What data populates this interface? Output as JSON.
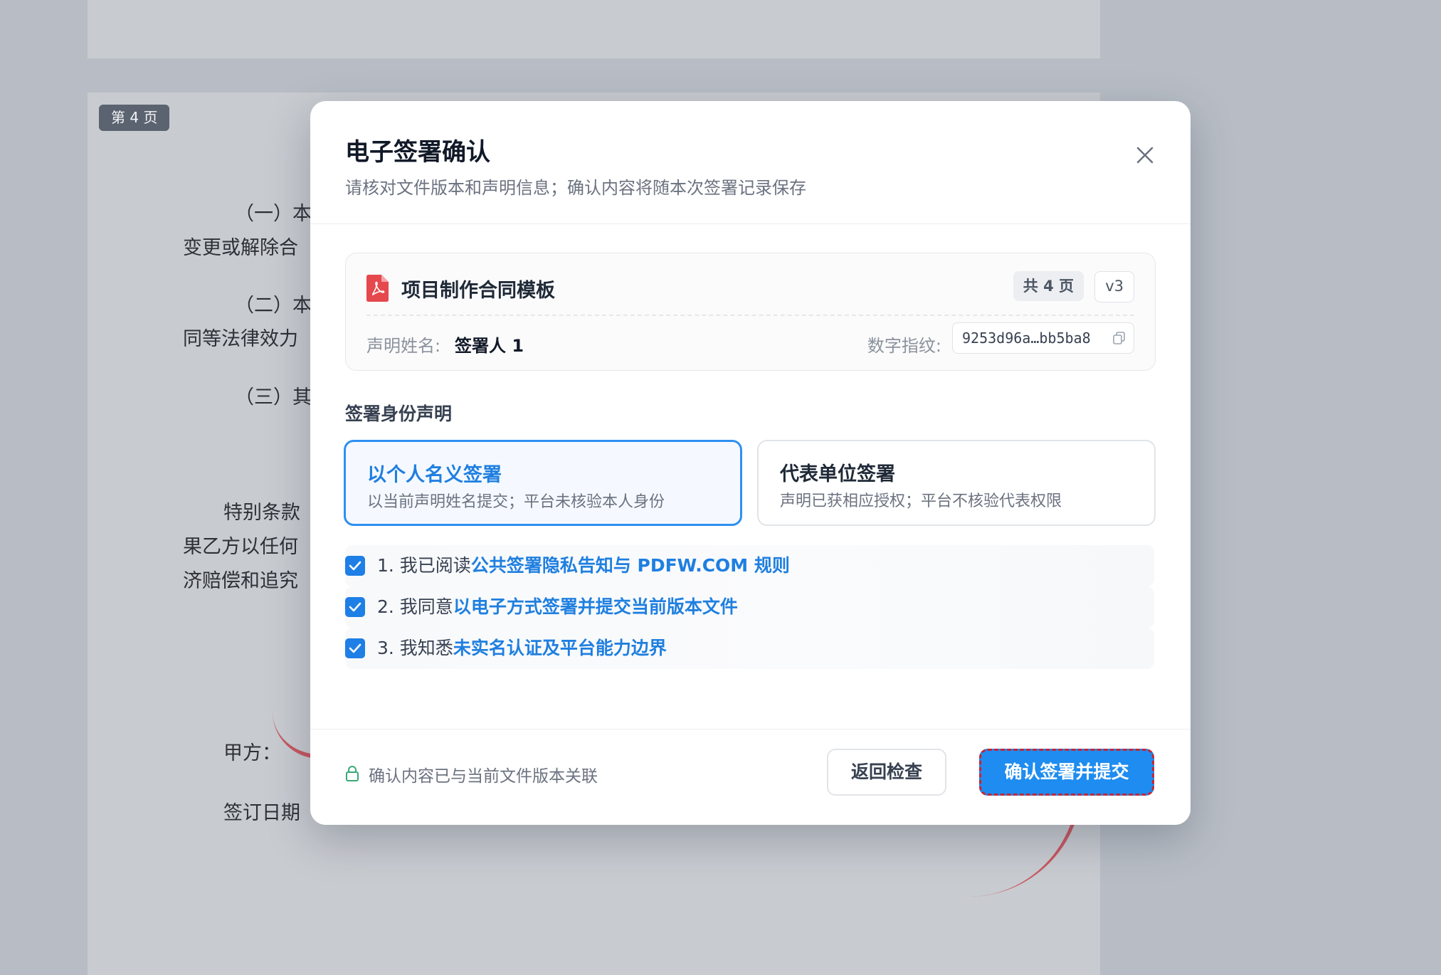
{
  "document": {
    "page_badge": "第 4 页",
    "lines": [
      "（一）本",
      "变更或解除合",
      "（二）本",
      "同等法律效力",
      "（三）其",
      "特别条款",
      "果乙方以任何",
      "济赔偿和追究",
      "甲方：",
      "签订日期"
    ]
  },
  "modal": {
    "title": "电子签署确认",
    "subtitle": "请核对文件版本和声明信息；确认内容将随本次签署记录保存",
    "close_icon": "close-icon",
    "file": {
      "icon": "pdf-file-icon",
      "name": "项目制作合同模板",
      "pages_tag": "共 4 页",
      "version_tag": "v3",
      "signer_label": "声明姓名:",
      "signer_value": "签署人 1",
      "fingerprint_label": "数字指纹:",
      "fingerprint_value": "9253d96a…bb5ba8",
      "copy_icon": "copy-icon"
    },
    "identity_section_title": "签署身份声明",
    "options": [
      {
        "title": "以个人名义签署",
        "desc": "以当前声明姓名提交；平台未核验本人身份",
        "selected": true
      },
      {
        "title": "代表单位签署",
        "desc": "声明已获相应授权；平台不核验代表权限",
        "selected": false
      }
    ],
    "checks": [
      {
        "prefix": "1. 我已阅读",
        "link": "公共签署隐私告知与 PDFW.COM 规则",
        "checked": true
      },
      {
        "prefix": "2. 我同意",
        "link": "以电子方式签署并提交当前版本文件",
        "checked": true
      },
      {
        "prefix": "3. 我知悉",
        "link": "未实名认证及平台能力边界",
        "checked": true
      }
    ],
    "footer": {
      "lock_icon": "lock-icon",
      "note": "确认内容已与当前文件版本关联",
      "back_label": "返回检查",
      "confirm_label": "确认签署并提交"
    }
  },
  "colors": {
    "accent": "#1e8cf0",
    "link": "#1f7fe0",
    "focus_outline": "#c0283a",
    "pdf_red": "#e5484d"
  }
}
